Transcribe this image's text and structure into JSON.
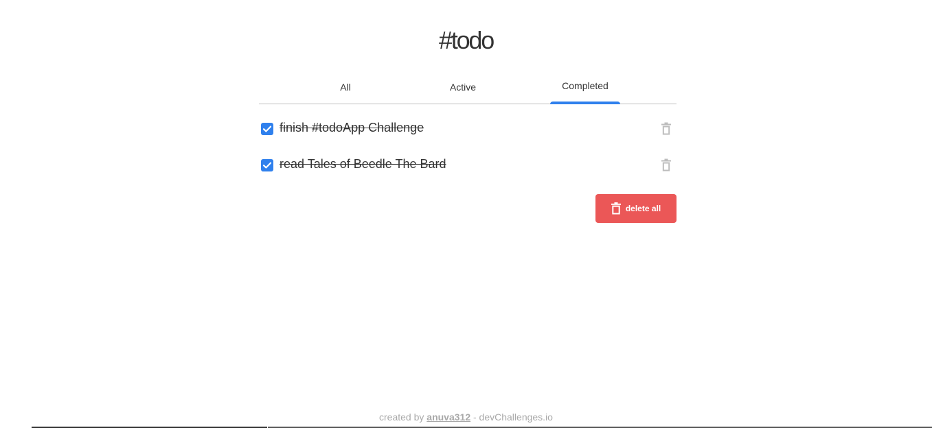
{
  "title": "#todo",
  "tabs": [
    {
      "label": "All"
    },
    {
      "label": "Active"
    },
    {
      "label": "Completed",
      "selected": true
    }
  ],
  "todos": [
    {
      "text": "finish #todoApp Challenge",
      "completed": true
    },
    {
      "text": "read Tales of Beedle The Bard",
      "completed": true
    }
  ],
  "delete_all": {
    "label": "delete all",
    "icon": "trash-icon"
  },
  "footer": {
    "prefix": "created by ",
    "author": "anuva312",
    "suffix": " - devChallenges.io"
  },
  "colors": {
    "accent": "#2f80ed",
    "danger": "#eb5757",
    "text": "#333333",
    "muted": "#bdbdbd"
  }
}
